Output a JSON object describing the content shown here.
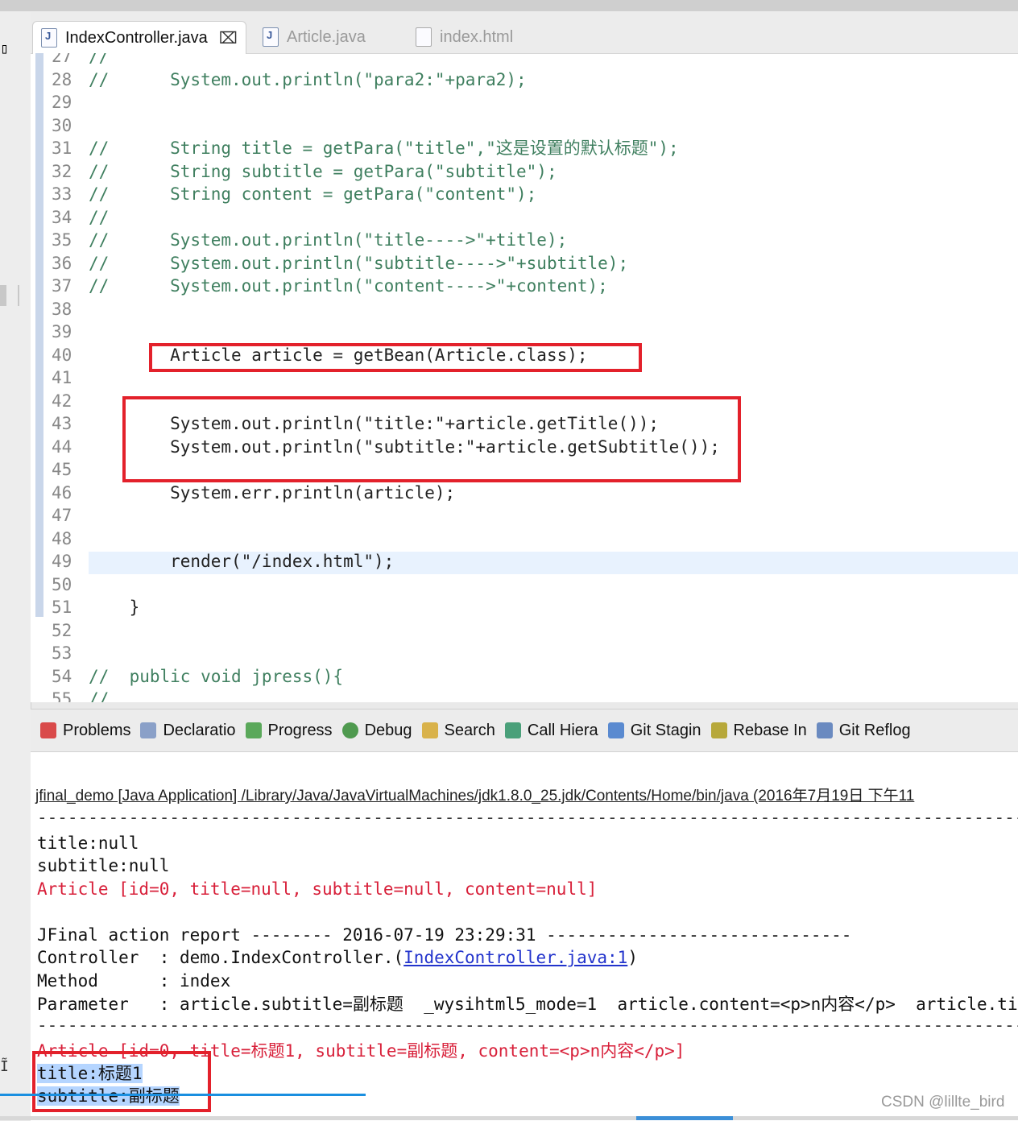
{
  "editor": {
    "tabs": [
      {
        "label": "IndexController.java",
        "active": true,
        "close": "⌧"
      },
      {
        "label": "Article.java",
        "active": false
      },
      {
        "label": "index.html",
        "active": false
      }
    ],
    "lines": [
      {
        "n": "27",
        "t": "//"
      },
      {
        "n": "28",
        "t": "//      System.out.println(\"para2:\"+para2);"
      },
      {
        "n": "29",
        "t": ""
      },
      {
        "n": "30",
        "t": ""
      },
      {
        "n": "31",
        "t": "//      String title = getPara(\"title\",\"这是设置的默认标题\");"
      },
      {
        "n": "32",
        "t": "//      String subtitle = getPara(\"subtitle\");"
      },
      {
        "n": "33",
        "t": "//      String content = getPara(\"content\");"
      },
      {
        "n": "34",
        "t": "//"
      },
      {
        "n": "35",
        "t": "//      System.out.println(\"title---->\"+title);"
      },
      {
        "n": "36",
        "t": "//      System.out.println(\"subtitle---->\"+subtitle);"
      },
      {
        "n": "37",
        "t": "//      System.out.println(\"content---->\"+content);"
      },
      {
        "n": "38",
        "t": ""
      },
      {
        "n": "39",
        "t": ""
      },
      {
        "n": "40",
        "t": "        Article article = getBean(Article.class);"
      },
      {
        "n": "41",
        "t": ""
      },
      {
        "n": "42",
        "t": ""
      },
      {
        "n": "43",
        "t": "        System.out.println(\"title:\"+article.getTitle());"
      },
      {
        "n": "44",
        "t": "        System.out.println(\"subtitle:\"+article.getSubtitle());"
      },
      {
        "n": "45",
        "t": ""
      },
      {
        "n": "46",
        "t": "        System.err.println(article);"
      },
      {
        "n": "47",
        "t": ""
      },
      {
        "n": "48",
        "t": ""
      },
      {
        "n": "49",
        "t": "        render(\"/index.html\");"
      },
      {
        "n": "50",
        "t": ""
      },
      {
        "n": "51",
        "t": "    }"
      },
      {
        "n": "52",
        "t": ""
      },
      {
        "n": "53",
        "t": ""
      },
      {
        "n": "54",
        "t": "//  public void jpress(){"
      },
      {
        "n": "55",
        "t": "//"
      }
    ]
  },
  "views": {
    "tabs": [
      "Problems",
      "Declaratio",
      "Progress",
      "Debug",
      "Search",
      "Call Hiera",
      "Git Stagin",
      "Rebase In",
      "Git Reflog"
    ]
  },
  "console": {
    "header": "jfinal_demo [Java Application] /Library/Java/JavaVirtualMachines/jdk1.8.0_25.jdk/Contents/Home/bin/java (2016年7月19日 下午11",
    "dashes1": "-------------------------------------------------------------------------------------------------------",
    "out1": "title:null",
    "out2": "subtitle:null",
    "err1": "Article [id=0, title=null, subtitle=null, content=null]",
    "report": "JFinal action report -------- 2016-07-19 23:29:31 ------------------------------",
    "controller_prefix": "Controller  : demo.IndexController.(",
    "controller_link": "IndexController.java:1",
    "controller_suffix": ")",
    "method": "Method      : index",
    "parameter": "Parameter   : article.subtitle=副标题  _wysihtml5_mode=1  article.content=<p>n内容</p>  article.titl",
    "dashes2": "-------------------------------------------------------------------------------------------------------",
    "err2": "Article [id=0, title=标题1, subtitle=副标题, content=<p>n内容</p>]",
    "out3": "title:标题1",
    "out4": "subtitle:副标题"
  },
  "watermark": "CSDN @lillte_bird",
  "colors": {
    "highlight_box": "#e3212b",
    "comment": "#3f7f5f",
    "error": "#d8203a"
  }
}
